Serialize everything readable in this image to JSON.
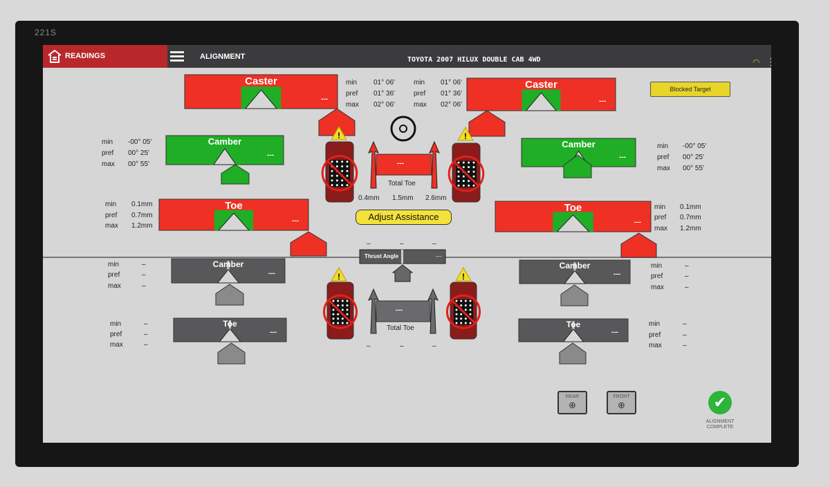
{
  "monitor": {
    "model": "221S"
  },
  "header": {
    "readings_label": "READINGS",
    "section_label": "ALIGNMENT",
    "vehicle": "TOYOTA 2007 HILUX DOUBLE CAB 4WD",
    "wifi_icon": "wifi-icon",
    "menu_icon": "hamburger-icon"
  },
  "colors": {
    "out_of_spec": "#ee3124",
    "in_spec": "#1fae25",
    "no_reading": "#58585a",
    "warning": "#f2dc2a",
    "header": "#3b3b3d",
    "readings_tab": "#b8282b"
  },
  "front": {
    "left": {
      "caster": {
        "label": "Caster",
        "value": "---",
        "status": "out_of_spec"
      },
      "camber": {
        "label": "Camber",
        "value": "---",
        "status": "in_spec",
        "specs": {
          "min": "-00° 05'",
          "pref": "00° 25'",
          "max": "00° 55'"
        }
      },
      "toe": {
        "label": "Toe",
        "value": "---",
        "status": "out_of_spec",
        "specs": {
          "min": "0.1mm",
          "pref": "0.7mm",
          "max": "1.2mm"
        }
      }
    },
    "right": {
      "caster": {
        "label": "Caster",
        "value": "---",
        "status": "out_of_spec"
      },
      "camber": {
        "label": "Camber",
        "value": "---",
        "status": "in_spec",
        "specs": {
          "min": "-00° 05'",
          "pref": "00° 25'",
          "max": "00° 55'"
        }
      },
      "toe": {
        "label": "Toe",
        "value": "---",
        "status": "out_of_spec",
        "specs": {
          "min": "0.1mm",
          "pref": "0.7mm",
          "max": "1.2mm"
        }
      }
    },
    "caster_specs": {
      "left": {
        "min": "01° 06'",
        "pref": "01° 36'",
        "max": "02° 06'"
      },
      "right": {
        "min": "01° 06'",
        "pref": "01° 36'",
        "max": "02° 06'"
      }
    },
    "total_toe": {
      "label": "Total Toe",
      "value": "---",
      "status": "out_of_spec",
      "min": "0.4mm",
      "pref": "1.5mm",
      "max": "2.6mm"
    }
  },
  "rear": {
    "left": {
      "camber": {
        "label": "Camber",
        "value": "---",
        "status": "no_reading",
        "specs": {
          "min": "–",
          "pref": "–",
          "max": "–"
        }
      },
      "toe": {
        "label": "Toe",
        "value": "---",
        "status": "no_reading",
        "specs": {
          "min": "–",
          "pref": "–",
          "max": "–"
        }
      }
    },
    "right": {
      "camber": {
        "label": "Camber",
        "value": "---",
        "status": "no_reading",
        "specs": {
          "min": "–",
          "pref": "–",
          "max": "–"
        }
      },
      "toe": {
        "label": "Toe",
        "value": "---",
        "status": "no_reading",
        "specs": {
          "min": "–",
          "pref": "–",
          "max": "–"
        }
      }
    },
    "thrust_angle": {
      "label": "Thrust Angle",
      "value": "---",
      "min": "–",
      "pref": "–",
      "max": "–"
    },
    "total_toe": {
      "label": "Total Toe",
      "value": "---",
      "status": "no_reading",
      "min": "–",
      "pref": "–",
      "max": "–"
    }
  },
  "spec_labels": {
    "min": "min",
    "pref": "pref",
    "max": "max"
  },
  "alerts": {
    "blocked_target": "Blocked Target"
  },
  "buttons": {
    "adjust_assistance": "Adjust Assistance",
    "rear_zoom": "REAR",
    "front_zoom": "FRONT",
    "alignment_complete_1": "ALIGNMENT",
    "alignment_complete_2": "COMPLETE"
  }
}
